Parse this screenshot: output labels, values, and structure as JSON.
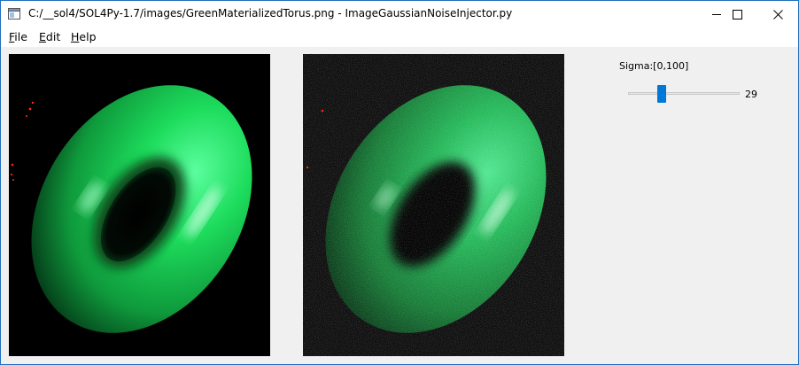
{
  "window": {
    "title": "C:/__sol4/SOL4Py-1.7/images/GreenMaterializedTorus.png - ImageGaussianNoiseInjector.py",
    "icon": "app-window-icon",
    "controls": [
      "minimize-icon",
      "maximize-icon",
      "close-icon"
    ]
  },
  "menu": {
    "file": {
      "first": "F",
      "rest": "ile"
    },
    "edit": {
      "first": "E",
      "rest": "dit"
    },
    "help": {
      "first": "H",
      "rest": "elp"
    }
  },
  "images": {
    "original": "green materialized torus on black background",
    "noisy": "green torus with gaussian noise applied"
  },
  "slider": {
    "label": "Sigma:[0,100]",
    "value": "29",
    "min": 0,
    "max": 100,
    "current": 29
  },
  "colors": {
    "accent": "#0078d7",
    "torus": "#1fdc62",
    "background": "#f0f0f0"
  }
}
